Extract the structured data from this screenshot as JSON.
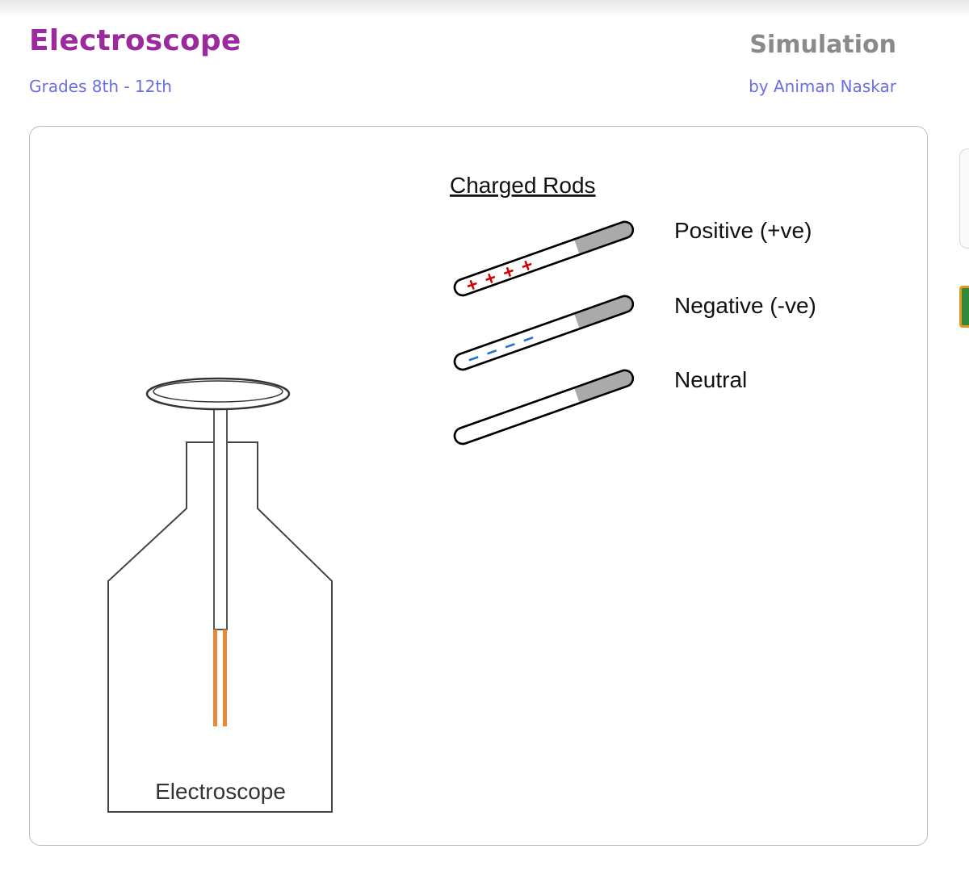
{
  "header": {
    "title": "Electroscope",
    "grades": "Grades 8th - 12th",
    "type": "Simulation",
    "author": "by Animan Naskar"
  },
  "simulation": {
    "rods_heading": "Charged Rods",
    "rods": [
      {
        "label": "Positive (+ve)",
        "charge": "positive",
        "charge_color": "#d40000"
      },
      {
        "label": "Negative (-ve)",
        "charge": "negative",
        "charge_color": "#1a6fd6"
      },
      {
        "label": "Neutral",
        "charge": "neutral"
      }
    ],
    "electroscope_label": "Electroscope",
    "leaf_color": "#e8893a"
  }
}
